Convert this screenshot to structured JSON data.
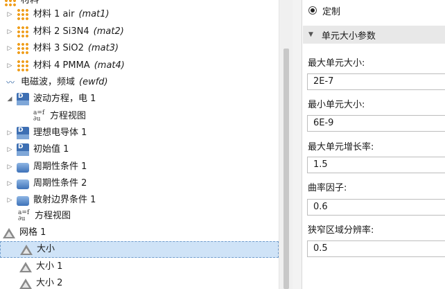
{
  "tree": {
    "partial_top": {
      "label": "材料"
    },
    "materials": [
      {
        "label": "材料 1 air",
        "tag": "(mat1)"
      },
      {
        "label": "材料 2 Si3N4",
        "tag": "(mat2)"
      },
      {
        "label": "材料 3 SiO2",
        "tag": "(mat3)"
      },
      {
        "label": "材料 4 PMMA",
        "tag": "(mat4)"
      }
    ],
    "physics": {
      "label": "电磁波，频域",
      "tag": "(ewfd)"
    },
    "wave_eq": {
      "label": "波动方程，电 1"
    },
    "wave_eq_view": {
      "label": "方程视图"
    },
    "pec": {
      "label": "理想电导体 1"
    },
    "init": {
      "label": "初始值 1"
    },
    "periodic1": {
      "label": "周期性条件 1"
    },
    "periodic2": {
      "label": "周期性条件 2"
    },
    "scatter": {
      "label": "散射边界条件 1"
    },
    "eq_view": {
      "label": "方程视图"
    },
    "mesh": {
      "label": "网格 1"
    },
    "size": {
      "label": "大小"
    },
    "size1": {
      "label": "大小 1"
    },
    "size2": {
      "label": "大小 2"
    }
  },
  "settings": {
    "radio_label": "定制",
    "section_title": "单元大小参数",
    "fields": [
      {
        "label": "最大单元大小:",
        "value": "2E-7"
      },
      {
        "label": "最小单元大小:",
        "value": "6E-9"
      },
      {
        "label": "最大单元增长率:",
        "value": "1.5"
      },
      {
        "label": "曲率因子:",
        "value": "0.6"
      },
      {
        "label": "狭窄区域分辨率:",
        "value": "0.5"
      }
    ]
  }
}
